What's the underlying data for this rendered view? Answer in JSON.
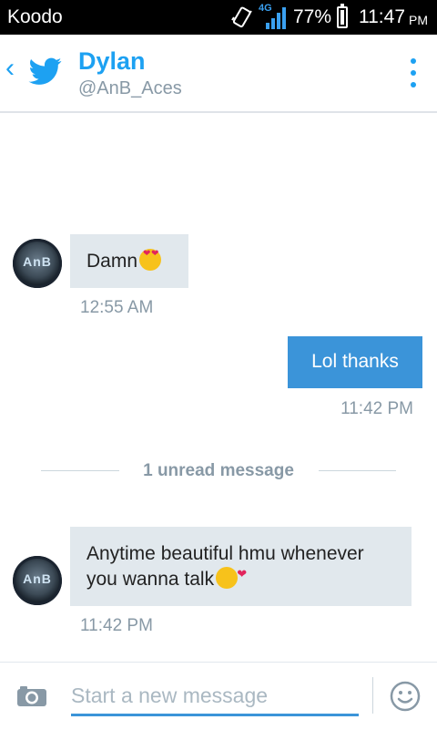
{
  "status_bar": {
    "carrier": "Koodo",
    "network": "4G",
    "battery": "77%",
    "time": "11:47",
    "ampm": "PM"
  },
  "header": {
    "name": "Dylan",
    "handle": "@AnB_Aces"
  },
  "messages": [
    {
      "direction": "in",
      "text": "Damn",
      "emoji": "heart-eyes-emoji",
      "time": "12:55 AM",
      "avatar_text": "AnB"
    },
    {
      "direction": "out",
      "text": "Lol thanks",
      "time": "11:42 PM"
    },
    {
      "direction": "in",
      "text": "Anytime beautiful hmu whenever you wanna talk",
      "emoji": "kiss-emoji",
      "time": "11:42 PM",
      "avatar_text": "AnB"
    }
  ],
  "unread_divider": "1 unread message",
  "composer": {
    "placeholder": "Start a new message"
  },
  "colors": {
    "accent": "#1da1f2",
    "outgoing_bubble": "#3b94d9",
    "incoming_bubble": "#e1e8ed",
    "muted_text": "#8899a6"
  }
}
